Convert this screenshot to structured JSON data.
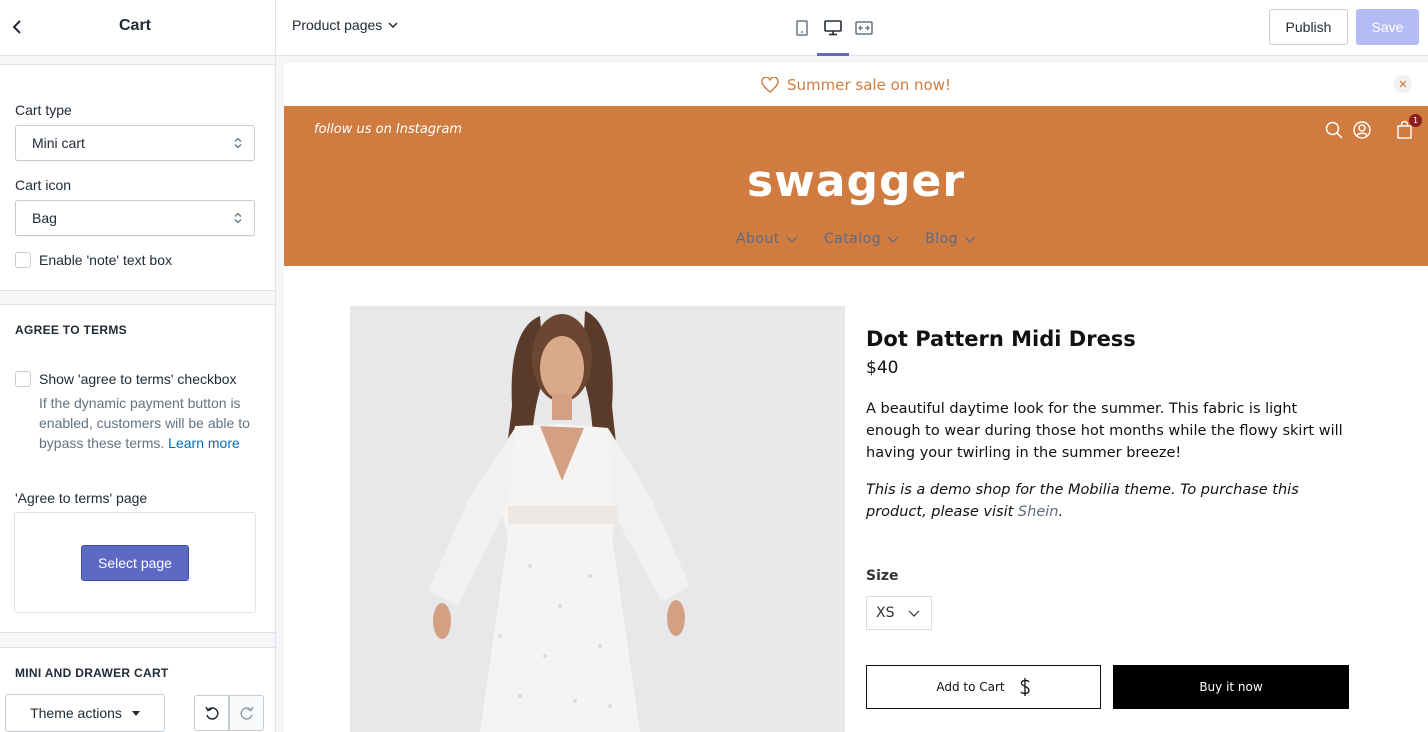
{
  "topbar": {
    "section_title": "Cart",
    "page_selector": "Product pages",
    "view_modes": [
      "mobile",
      "desktop",
      "fullscreen"
    ],
    "active_view": "desktop",
    "publish_label": "Publish",
    "save_label": "Save"
  },
  "sidebar": {
    "cart_type_label": "Cart type",
    "cart_type_value": "Mini cart",
    "cart_icon_label": "Cart icon",
    "cart_icon_value": "Bag",
    "note_checkbox_label": "Enable 'note' text box",
    "agree_section_title": "AGREE TO TERMS",
    "agree_checkbox_label": "Show 'agree to terms' checkbox",
    "agree_help_text": "If the dynamic payment button is enabled, customers will be able to bypass these terms.",
    "agree_help_link": "Learn more",
    "terms_page_label": "'Agree to terms' page",
    "select_page_label": "Select page",
    "mini_drawer_section_title": "MINI AND DRAWER CART",
    "theme_actions_label": "Theme actions"
  },
  "preview": {
    "announcement": "Summer sale on now!",
    "social_text": "follow us on Instagram",
    "logo_text": "swagger",
    "cart_count": "1",
    "nav": [
      {
        "label": "About"
      },
      {
        "label": "Catalog"
      },
      {
        "label": "Blog"
      }
    ],
    "product": {
      "title": "Dot Pattern Midi Dress",
      "price": "$40",
      "description": "A beautiful daytime look for the summer. This fabric is light enough to wear during those hot months while the flowy skirt will having your twirling in the summer breeze!",
      "note_prefix": "This is a demo shop for the Mobilia theme. To purchase this product, please visit",
      "note_link": "Shein",
      "note_suffix": ".",
      "size_label": "Size",
      "size_value": "XS",
      "add_to_cart_label": "Add to Cart",
      "buy_now_label": "Buy it now"
    }
  },
  "colors": {
    "header_orange": "#d07c40",
    "primary_indigo": "#5c6ac4",
    "save_disabled": "#b3bcf5",
    "nav_text": "#5e6b85",
    "badge": "#8b1e1e"
  }
}
